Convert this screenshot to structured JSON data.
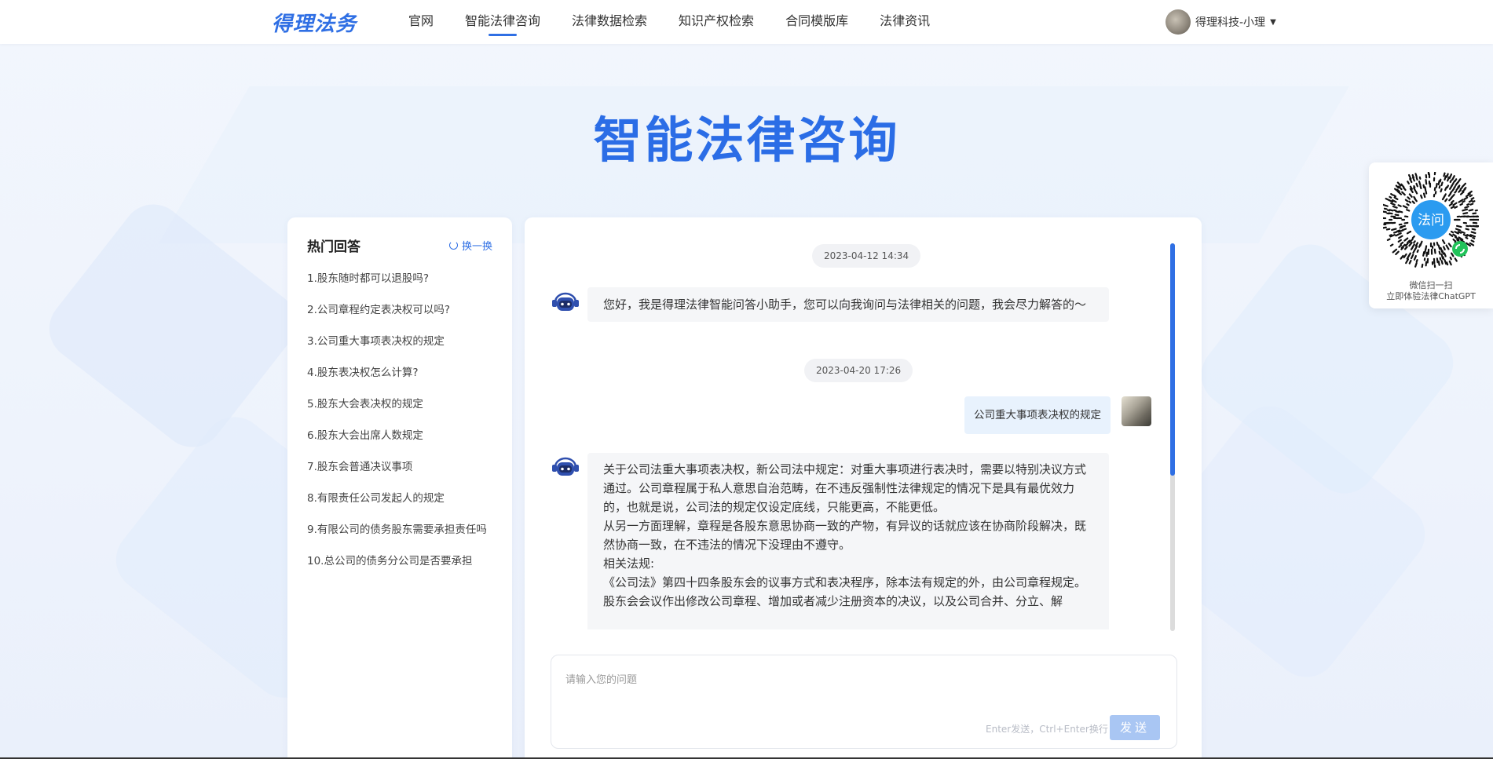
{
  "brand": {
    "logo_text": "得理法务"
  },
  "nav": {
    "items": [
      {
        "label": "官网",
        "active": false
      },
      {
        "label": "智能法律咨询",
        "active": true
      },
      {
        "label": "法律数据检索",
        "active": false
      },
      {
        "label": "知识产权检索",
        "active": false
      },
      {
        "label": "合同模版库",
        "active": false
      },
      {
        "label": "法律资讯",
        "active": false
      }
    ],
    "user_name": "得理科技-小理",
    "accent_color": "#2f6fe4"
  },
  "page": {
    "title": "智能法律咨询"
  },
  "hot": {
    "title": "热门回答",
    "refresh_label": "换一换",
    "items": [
      "1.股东随时都可以退股吗?",
      "2.公司章程约定表决权可以吗?",
      "3.公司重大事项表决权的规定",
      "4.股东表决权怎么计算?",
      "5.股东大会表决权的规定",
      "6.股东大会出席人数规定",
      "7.股东会普通决议事项",
      "8.有限责任公司发起人的规定",
      "9.有限公司的债务股东需要承担责任吗",
      "10.总公司的债务分公司是否要承担"
    ]
  },
  "chat": {
    "timestamp_1": "2023-04-12 14:34",
    "greeting": "您好，我是得理法律智能问答小助手，您可以向我询问与法律相关的问题，我会尽力解答的～",
    "timestamp_2": "2023-04-20 17:26",
    "user_question": "公司重大事项表决权的规定",
    "answer_lines": [
      "关于公司法重大事项表决权，新公司法中规定：对重大事项进行表决时，需要以特别决议方式通过。公司章程属于私人意思自治范畴，在不违反强制性法律规定的情况下是具有最优效力的，也就是说，公司法的规定仅设定底线，只能更高，不能更低。",
      "从另一方面理解，章程是各股东意思协商一致的产物，有异议的话就应该在协商阶段解决，既然协商一致，在不违法的情况下没理由不遵守。",
      "相关法规:",
      "《公司法》第四十四条股东会的议事方式和表决程序，除本法有规定的外，由公司章程规定。",
      "股东会会议作出修改公司章程、增加或者减少注册资本的决议，以及公司合并、分立、解"
    ],
    "scroll_fraction": 0.6
  },
  "input": {
    "placeholder": "请输入您的问题",
    "hint": "Enter发送，Ctrl+Enter换行",
    "send_label": "发送"
  },
  "qr": {
    "center_text": "法问",
    "line1": "微信扫一扫",
    "line2": "立即体验法律ChatGPT"
  }
}
